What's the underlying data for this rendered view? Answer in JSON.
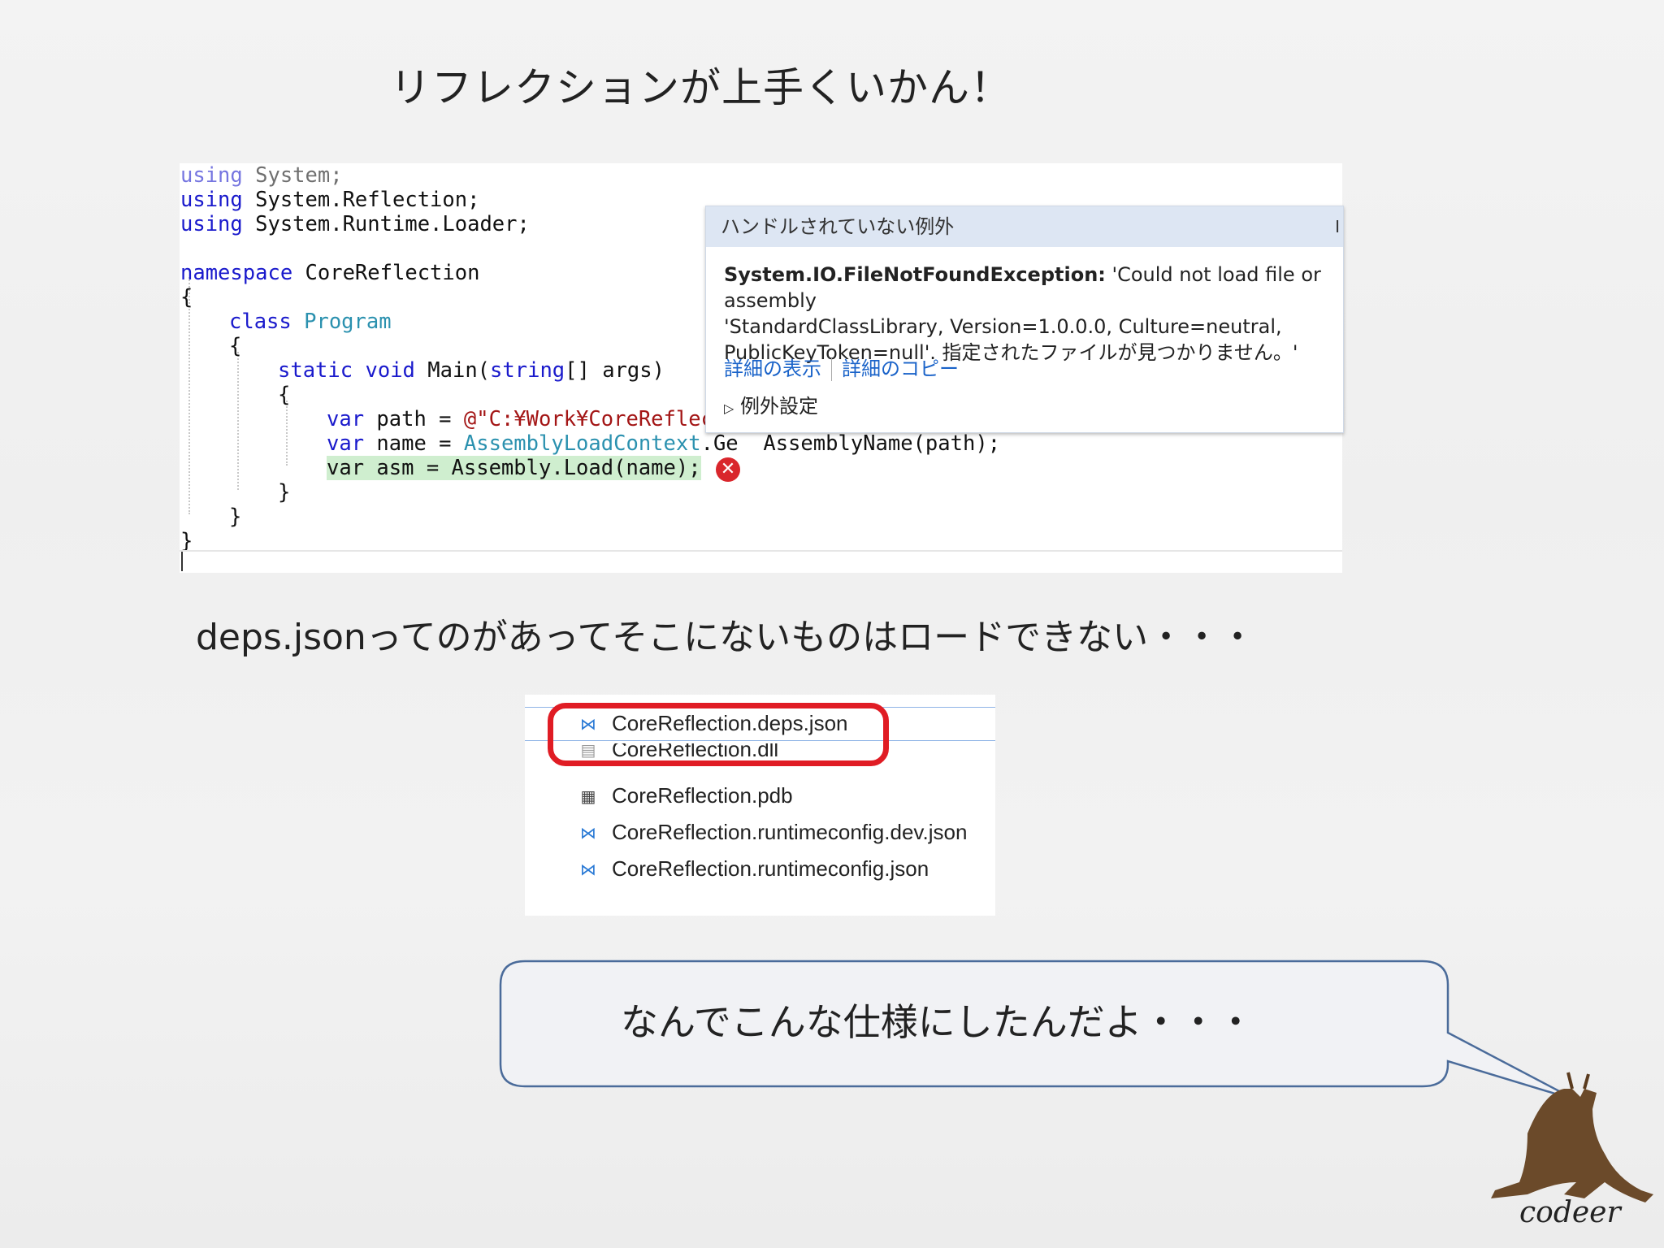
{
  "slide": {
    "title": "リフレクションが上手くいかん！",
    "caption": "deps.jsonってのがあってそこにないものはロードできない・・・",
    "bubble_text": "なんでこんな仕様にしたんだよ・・・",
    "logo": "codeer"
  },
  "code": {
    "l1_kw": "using",
    "l1_rest": " System;",
    "l2_kw": "using",
    "l2_rest": " System.Reflection;",
    "l3_kw": "using",
    "l3_rest": " System.Runtime.Loader;",
    "l4_kw": "namespace",
    "l4_rest": " CoreReflection",
    "l5": "{",
    "l6_kw": "class",
    "l6_type": "Program",
    "l7": "{",
    "l8_kw1": "static",
    "l8_kw2": "void",
    "l8_mid": " Main(",
    "l8_kw3": "string",
    "l8_rest": "[] args)",
    "l9": "{",
    "l10_kw": "var",
    "l10_mid": " path = ",
    "l10_str": "@\"C:¥Work¥CoreReflec",
    "l11_kw": "var",
    "l11_mid": " name = ",
    "l11_type": "AssemblyLoadContext",
    "l11_rest": ".Ge  AssemblyName(path);",
    "l12": "var asm = Assembly.Load(name);",
    "l13": "}",
    "l14": "}",
    "l15": "}"
  },
  "exception": {
    "header": "ハンドルされていない例外",
    "type": "System.IO.FileNotFoundException:",
    "message_1": " 'Could not load file or assembly",
    "message_2": "'StandardClassLibrary, Version=1.0.0.0, Culture=neutral,",
    "message_3": "PublicKeyToken=null'. 指定されたファイルが見つかりません。'",
    "link_details": "詳細の表示",
    "link_copy": "詳細のコピー",
    "settings": "例外設定",
    "close_glyph": "I",
    "settings_arrow": "▷"
  },
  "files": [
    {
      "name": "CoreReflection.deps.json",
      "icon": "vs-json-icon",
      "glyph": "⋈"
    },
    {
      "name": "CoreReflection.dll",
      "icon": "dll-icon",
      "glyph": "▤"
    },
    {
      "name": "CoreReflection.pdb",
      "icon": "pdb-icon",
      "glyph": "▦"
    },
    {
      "name": "CoreReflection.runtimeconfig.dev.json",
      "icon": "vs-json-icon",
      "glyph": "⋈"
    },
    {
      "name": "CoreReflection.runtimeconfig.json",
      "icon": "vs-json-icon",
      "glyph": "⋈"
    }
  ],
  "colors": {
    "keyword": "#1a1acc",
    "type": "#2b91af",
    "string": "#a31515",
    "highlight": "#cfeecf",
    "error": "#d9262c",
    "red_mark": "#e01c24",
    "bubble_border": "#4a6b9a"
  }
}
